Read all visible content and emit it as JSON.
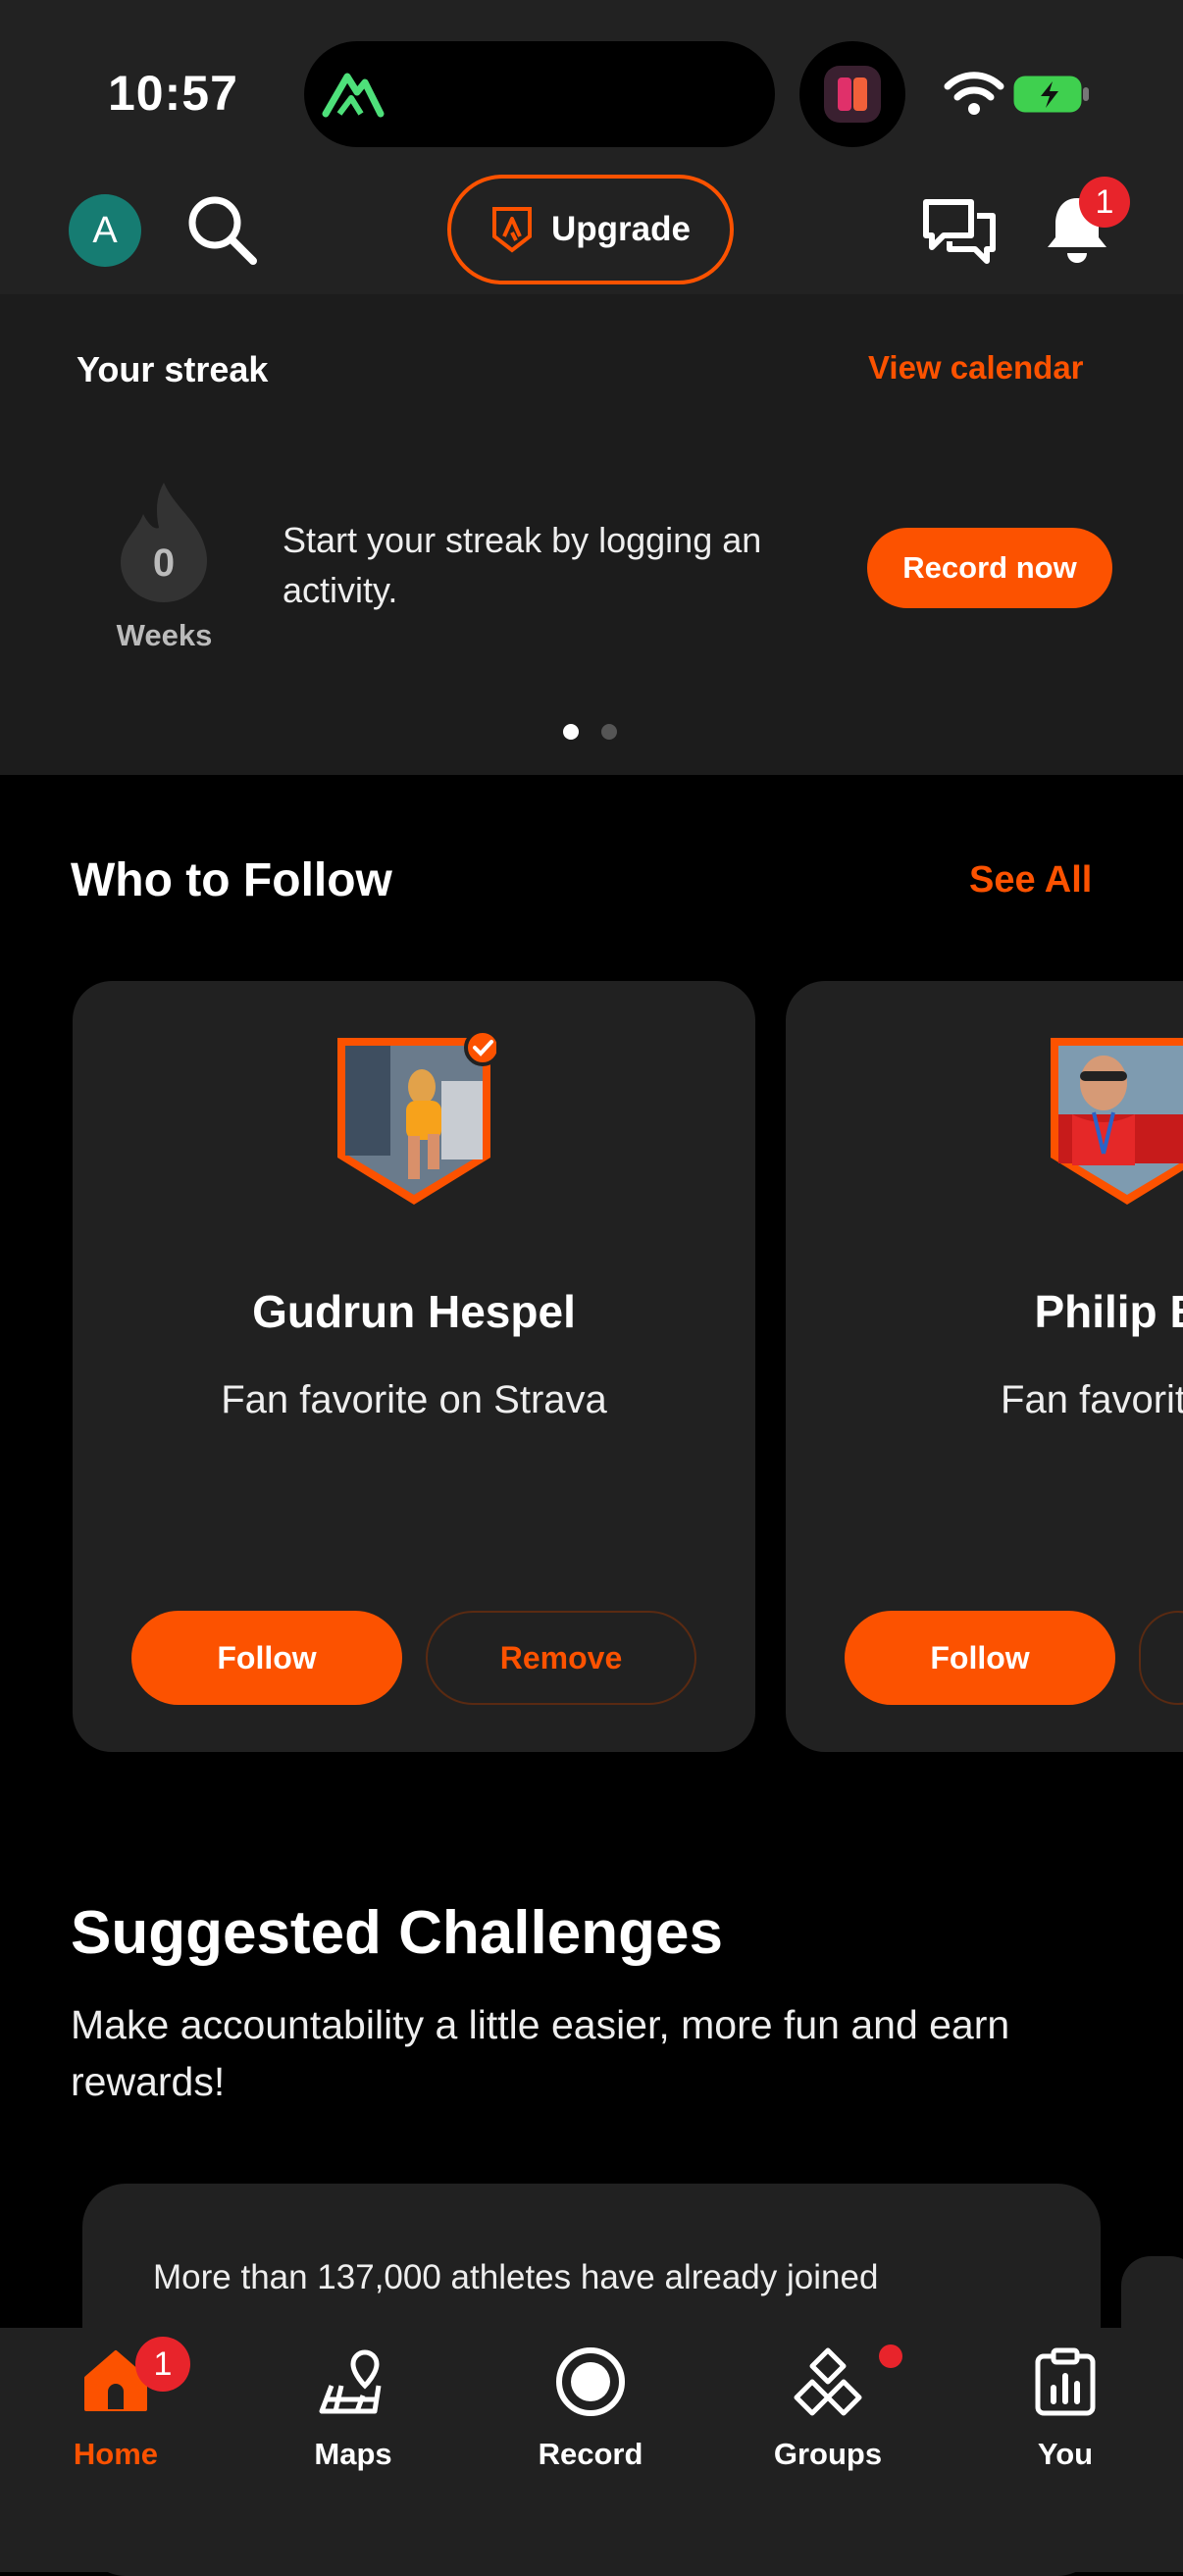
{
  "status_bar": {
    "time": "10:57"
  },
  "header": {
    "avatar_initial": "A",
    "upgrade_label": "Upgrade",
    "notifications_count": "1"
  },
  "streak": {
    "title": "Your streak",
    "view_calendar": "View calendar",
    "count": "0",
    "unit": "Weeks",
    "message": "Start your streak by logging an activity.",
    "record_button": "Record now",
    "page_indicator": {
      "pages": 2,
      "current": 1
    }
  },
  "who_to_follow": {
    "title": "Who to Follow",
    "see_all": "See All",
    "cards": [
      {
        "name": "Gudrun Hespel",
        "subtitle": "Fan favorite on Strava",
        "verified": true,
        "follow": "Follow",
        "remove": "Remove"
      },
      {
        "name": "Philip Br",
        "subtitle": "Fan favorite or",
        "follow": "Follow"
      }
    ]
  },
  "challenges": {
    "title": "Suggested Challenges",
    "subtitle": "Make accountability a little easier, more fun and earn rewards!",
    "card_text": "More than 137,000 athletes have already joined"
  },
  "nav": {
    "items": [
      {
        "label": "Home",
        "icon": "home-icon",
        "badge": "1",
        "active": true
      },
      {
        "label": "Maps",
        "icon": "maps-icon"
      },
      {
        "label": "Record",
        "icon": "record-icon"
      },
      {
        "label": "Groups",
        "icon": "groups-icon",
        "dot": true
      },
      {
        "label": "You",
        "icon": "you-icon"
      }
    ]
  },
  "colors": {
    "accent": "#fc5200",
    "badge": "#e8242b",
    "avatar": "#167c72"
  }
}
